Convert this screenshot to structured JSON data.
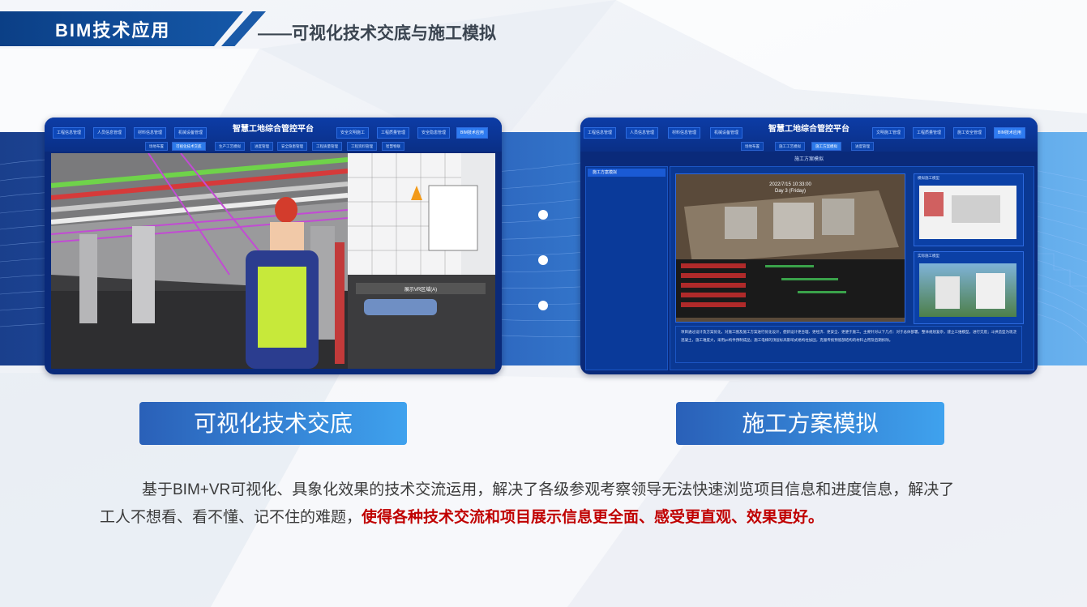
{
  "header": {
    "title": "BIM技术应用",
    "subtitle": "——可视化技术交底与施工模拟"
  },
  "screen_left": {
    "platform_title": "智慧工地综合管控平台",
    "nav_left": [
      "工程信息管理",
      "人员信息管理",
      "材料信息管理",
      "机械设备管理"
    ],
    "nav_right": [
      "安全文明施工",
      "工程质量管理",
      "安全隐患管理",
      "BIM技术应用"
    ],
    "subnav": [
      "场地布置",
      "可视化技术交底",
      "生产工艺模拟",
      "进度管理",
      "安全隐患管理",
      "工程质量管理",
      "工程资料管理",
      "智慧物联"
    ],
    "active_subnav_index": 1,
    "overlay_label": "展示VR区域(A)"
  },
  "screen_right": {
    "platform_title": "智慧工地综合管控平台",
    "nav_left": [
      "工程信息管理",
      "人员信息管理",
      "材料信息管理",
      "机械设备管理"
    ],
    "nav_right": [
      "文明施工管理",
      "工程质量管理",
      "施工安全管理",
      "BIM技术应用"
    ],
    "subnav": [
      "场地布置",
      "施工工艺模拟",
      "施工方案模拟",
      "进度管理"
    ],
    "active_subnav_index": 2,
    "section_title": "施工方案模拟",
    "sidebar_item": "施工方案模拟",
    "video_date": "2022/7/15 10:33:00",
    "video_day": "Day 3 (Friday)",
    "thumb_top_title": "模拟施工模型",
    "thumb_bottom_title": "实际施工模型",
    "desc_text": "项目通过设计及方案优化，对施工图及施工方案进行优化设计，使新设计更合理、更经济、更安全、更便于施工。主要针对以下几点：对于总体部署，整体规划复杂，建立三维模型，进行交底；斗拱造型为现浇混凝土，施工难度大，采用pc构件预制成品；施工电梯的顶层标高影响式格构柱加固，克服传统预留部结构的材料占用及后期拆除。"
  },
  "labels": {
    "left": "可视化技术交底",
    "right": "施工方案模拟"
  },
  "description": {
    "normal": "基于BIM+VR可视化、具象化效果的技术交流运用，解决了各级参观考察领导无法快速浏览项目信息和进度信息，解决了工人不想看、看不懂、记不住的难题，",
    "highlight": "使得各种技术交流和项目展示信息更全面、感受更直观、效果更好。"
  },
  "colors": {
    "brand_blue": "#0b3f86",
    "accent_blue": "#3fa2ee",
    "highlight_red": "#c00000"
  }
}
